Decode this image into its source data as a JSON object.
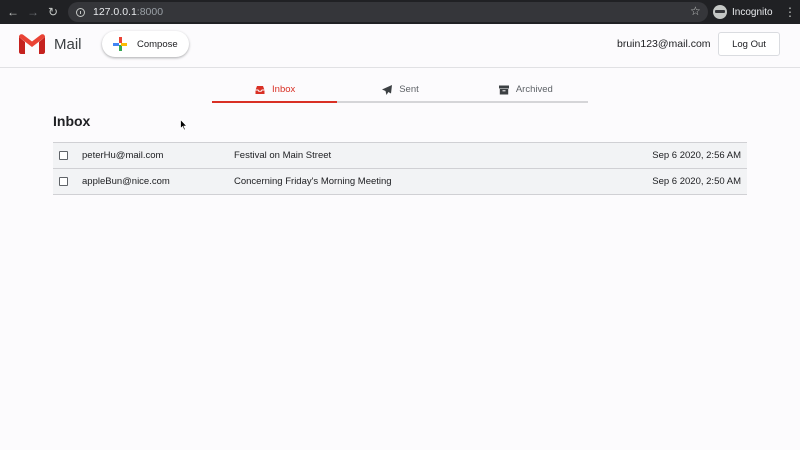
{
  "browser": {
    "url_host": "127.0.0.1",
    "url_port": ":8000",
    "incognito_label": "Incognito"
  },
  "header": {
    "app_name": "Mail",
    "compose_label": "Compose",
    "user_email": "bruin123@mail.com",
    "logout_label": "Log Out"
  },
  "tabs": [
    {
      "label": "Inbox",
      "icon": "inbox-icon",
      "active": true
    },
    {
      "label": "Sent",
      "icon": "paper-plane-icon",
      "active": false
    },
    {
      "label": "Archived",
      "icon": "archive-box-icon",
      "active": false
    }
  ],
  "main": {
    "title": "Inbox",
    "emails": [
      {
        "sender": "peterHu@mail.com",
        "subject": "Festival on Main Street",
        "date": "Sep 6 2020, 2:56 AM"
      },
      {
        "sender": "appleBun@nice.com",
        "subject": "Concerning Friday's Morning Meeting",
        "date": "Sep 6 2020, 2:50 AM"
      }
    ]
  },
  "colors": {
    "accent": "#d93025",
    "browser_bar": "#202124",
    "row_background": "#f2f3f5"
  }
}
